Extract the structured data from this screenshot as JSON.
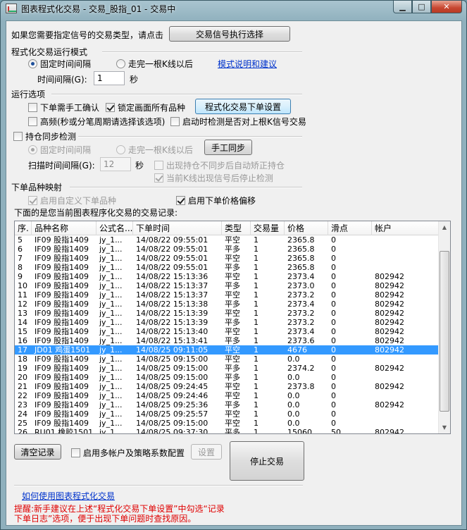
{
  "window": {
    "title": "图表程式化交易 - 交易_股指_01 - 交易中"
  },
  "signal": {
    "prompt": "如果您需要指定信号的交易类型，请点击",
    "button": "交易信号执行选择"
  },
  "run_mode": {
    "title": "程式化交易运行模式",
    "option_fixed": "固定时间间隔",
    "option_bar": "走完一根K线以后",
    "help_link": "模式说明和建议",
    "interval_label": "时间间隔(G):",
    "interval_value": "1",
    "interval_unit": "秒"
  },
  "run_options": {
    "title": "运行选项",
    "manual_confirm": "下单需手工确认",
    "lock_all": "锁定画面所有品种",
    "order_settings_button": "程式化交易下单设置",
    "high_freq": "高频(秒或分笔周期请选择该选项)",
    "check_last_bar": "启动时检测是否对上根K信号交易"
  },
  "position_sync": {
    "title": "持仓同步检测",
    "option_fixed": "固定时间间隔",
    "option_bar": "走完一根K线以后",
    "manual_sync_button": "手工同步",
    "scan_label": "扫描时间间隔(G):",
    "scan_value": "12",
    "scan_unit": "秒",
    "auto_correct": "出现持仓不同步后自动矫正持仓",
    "stop_on_signal": "当前K线出现信号后停止检测"
  },
  "mapping": {
    "title": "下单品种映射",
    "custom_symbol": "启用自定义下单品种",
    "price_offset": "启用下单价格偏移"
  },
  "records": {
    "caption": "下面的是您当前图表程序化交易的交易记录:",
    "columns": [
      "序.",
      "品种名称",
      "公式名...",
      "下单时间",
      "类型",
      "交易量",
      "价格",
      "滑点",
      "帐户"
    ],
    "rows": [
      [
        "5",
        "IF09 股指1409",
        "jy_1...",
        "14/08/22 09:55:01",
        "平空",
        "1",
        "2365.8",
        "0",
        ""
      ],
      [
        "6",
        "IF09 股指1409",
        "jy_1...",
        "14/08/22 09:55:01",
        "平多",
        "1",
        "2365.8",
        "0",
        ""
      ],
      [
        "7",
        "IF09 股指1409",
        "jy_1...",
        "14/08/22 09:55:01",
        "平空",
        "1",
        "2365.8",
        "0",
        ""
      ],
      [
        "8",
        "IF09 股指1409",
        "jy_1...",
        "14/08/22 09:55:01",
        "平多",
        "1",
        "2365.8",
        "0",
        ""
      ],
      [
        "9",
        "IF09 股指1409",
        "jy_1...",
        "14/08/22 15:13:36",
        "平空",
        "1",
        "2373.4",
        "0",
        "802942"
      ],
      [
        "10",
        "IF09 股指1409",
        "jy_1...",
        "14/08/22 15:13:37",
        "平多",
        "1",
        "2373.0",
        "0",
        "802942"
      ],
      [
        "11",
        "IF09 股指1409",
        "jy_1...",
        "14/08/22 15:13:37",
        "平空",
        "1",
        "2373.2",
        "0",
        "802942"
      ],
      [
        "12",
        "IF09 股指1409",
        "jy_1...",
        "14/08/22 15:13:38",
        "平多",
        "1",
        "2373.4",
        "0",
        "802942"
      ],
      [
        "13",
        "IF09 股指1409",
        "jy_1...",
        "14/08/22 15:13:39",
        "平空",
        "1",
        "2373.2",
        "0",
        "802942"
      ],
      [
        "14",
        "IF09 股指1409",
        "jy_1...",
        "14/08/22 15:13:39",
        "平多",
        "1",
        "2373.2",
        "0",
        "802942"
      ],
      [
        "15",
        "IF09 股指1409",
        "jy_1...",
        "14/08/22 15:13:40",
        "平空",
        "1",
        "2373.4",
        "0",
        "802942"
      ],
      [
        "16",
        "IF09 股指1409",
        "jy_1...",
        "14/08/22 15:13:41",
        "平多",
        "1",
        "2373.6",
        "0",
        "802942"
      ],
      [
        "17",
        "JD01 鸡蛋1501",
        "jy_1...",
        "14/08/25 09:11:05",
        "平空",
        "1",
        "4676",
        "0",
        "802942"
      ],
      [
        "18",
        "IF09 股指1409",
        "jy_1...",
        "14/08/25 09:15:00",
        "平空",
        "1",
        "0.0",
        "0",
        ""
      ],
      [
        "19",
        "IF09 股指1409",
        "jy_1...",
        "14/08/25 09:15:00",
        "平多",
        "1",
        "2374.2",
        "0",
        "802942"
      ],
      [
        "20",
        "IF09 股指1409",
        "jy_1...",
        "14/08/25 09:15:00",
        "平多",
        "1",
        "0.0",
        "0",
        ""
      ],
      [
        "21",
        "IF09 股指1409",
        "jy_1...",
        "14/08/25 09:24:45",
        "平空",
        "1",
        "2373.8",
        "0",
        "802942"
      ],
      [
        "22",
        "IF09 股指1409",
        "jy_1...",
        "14/08/25 09:24:46",
        "平空",
        "1",
        "0.0",
        "0",
        ""
      ],
      [
        "23",
        "IF09 股指1409",
        "jy_1...",
        "14/08/25 09:25:36",
        "平多",
        "1",
        "0.0",
        "0",
        "802942"
      ],
      [
        "24",
        "IF09 股指1409",
        "jy_1...",
        "14/08/25 09:25:57",
        "平空",
        "1",
        "0.0",
        "0",
        ""
      ],
      [
        "25",
        "IF09 股指1409",
        "jy_1...",
        "14/08/25 09:15:00",
        "平空",
        "1",
        "0.0",
        "0",
        ""
      ],
      [
        "26",
        "RU01 橡胶1501",
        "jy_1...",
        "14/08/25 09:37:30",
        "平多",
        "1",
        "15060",
        "50",
        "802942"
      ]
    ],
    "selected_row": 12
  },
  "bottom": {
    "clear_button": "清空记录",
    "multi_account": "启用多帐户及策略系数配置",
    "settings_button": "设置",
    "stop_button": "停止交易",
    "howto_link": "如何使用图表程式化交易",
    "tip_line1": "提醒:新手建议在上述“程式化交易下单设置”中勾选“记录",
    "tip_line2": "下单日志”选项，便于出现下单问题时查找原因。"
  },
  "colors": {
    "selection": "#3399ff",
    "link": "#0033cc",
    "tip": "#e00000"
  }
}
